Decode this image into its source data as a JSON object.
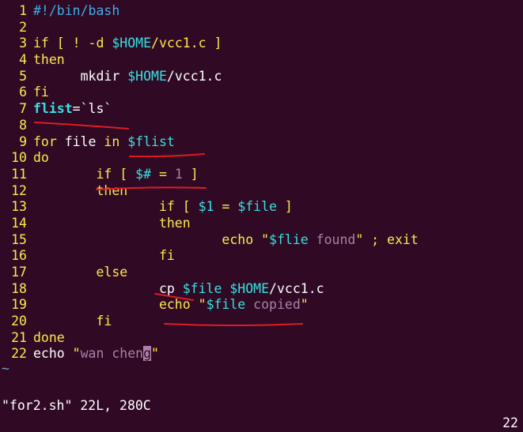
{
  "editor": {
    "lines": [
      {
        "n": "1",
        "tokens": [
          {
            "t": "#!/bin/bash",
            "c": "blue"
          }
        ]
      },
      {
        "n": "2",
        "tokens": []
      },
      {
        "n": "3",
        "tokens": [
          {
            "t": "if",
            "c": "yellow"
          },
          {
            "t": " [ ! -d ",
            "c": "yellow"
          },
          {
            "t": "$HOME",
            "c": "cyan"
          },
          {
            "t": "/vcc1.c ]",
            "c": "yellow"
          }
        ]
      },
      {
        "n": "4",
        "tokens": [
          {
            "t": "then",
            "c": "yellow"
          }
        ]
      },
      {
        "n": "5",
        "tokens": [
          {
            "t": "      mkdir ",
            "c": "white"
          },
          {
            "t": "$HOME",
            "c": "cyan"
          },
          {
            "t": "/vcc1.c",
            "c": "white"
          }
        ]
      },
      {
        "n": "6",
        "tokens": [
          {
            "t": "fi",
            "c": "yellow"
          }
        ]
      },
      {
        "n": "7",
        "tokens": [
          {
            "t": "flist",
            "c": "cyan",
            "b": true
          },
          {
            "t": "=`ls`",
            "c": "white"
          }
        ]
      },
      {
        "n": "8",
        "tokens": []
      },
      {
        "n": "9",
        "tokens": [
          {
            "t": "for",
            "c": "yellow"
          },
          {
            "t": " file ",
            "c": "white"
          },
          {
            "t": "in",
            "c": "yellow"
          },
          {
            "t": " ",
            "c": "white"
          },
          {
            "t": "$flist",
            "c": "cyan"
          }
        ]
      },
      {
        "n": "10",
        "tokens": [
          {
            "t": "do",
            "c": "yellow"
          }
        ]
      },
      {
        "n": "11",
        "tokens": [
          {
            "t": "        if",
            "c": "yellow"
          },
          {
            "t": " [ ",
            "c": "yellow"
          },
          {
            "t": "$#",
            "c": "cyan"
          },
          {
            "t": " = ",
            "c": "yellow"
          },
          {
            "t": "1",
            "c": "purple"
          },
          {
            "t": " ]",
            "c": "yellow"
          }
        ]
      },
      {
        "n": "12",
        "tokens": [
          {
            "t": "        then",
            "c": "yellow"
          }
        ]
      },
      {
        "n": "13",
        "tokens": [
          {
            "t": "                if",
            "c": "yellow"
          },
          {
            "t": " [ ",
            "c": "yellow"
          },
          {
            "t": "$1",
            "c": "cyan"
          },
          {
            "t": " = ",
            "c": "yellow"
          },
          {
            "t": "$file",
            "c": "cyan"
          },
          {
            "t": " ]",
            "c": "yellow"
          }
        ]
      },
      {
        "n": "14",
        "tokens": [
          {
            "t": "                then",
            "c": "yellow"
          }
        ]
      },
      {
        "n": "15",
        "tokens": [
          {
            "t": "                        echo ",
            "c": "yellow"
          },
          {
            "t": "\"",
            "c": "yellow"
          },
          {
            "t": "$flie",
            "c": "cyan"
          },
          {
            "t": " found",
            "c": "purple"
          },
          {
            "t": "\"",
            "c": "yellow"
          },
          {
            "t": " ; exit",
            "c": "yellow"
          }
        ]
      },
      {
        "n": "16",
        "tokens": [
          {
            "t": "                fi",
            "c": "yellow"
          }
        ]
      },
      {
        "n": "17",
        "tokens": [
          {
            "t": "        else",
            "c": "yellow"
          }
        ]
      },
      {
        "n": "18",
        "tokens": [
          {
            "t": "                cp ",
            "c": "white"
          },
          {
            "t": "$file",
            "c": "cyan"
          },
          {
            "t": " ",
            "c": "white"
          },
          {
            "t": "$HOME",
            "c": "cyan"
          },
          {
            "t": "/vcc1.c",
            "c": "white"
          }
        ]
      },
      {
        "n": "19",
        "tokens": [
          {
            "t": "                echo ",
            "c": "yellow"
          },
          {
            "t": "\"",
            "c": "yellow"
          },
          {
            "t": "$file",
            "c": "cyan"
          },
          {
            "t": " copied",
            "c": "purple"
          },
          {
            "t": "\"",
            "c": "yellow"
          }
        ]
      },
      {
        "n": "20",
        "tokens": [
          {
            "t": "        fi",
            "c": "yellow"
          }
        ]
      },
      {
        "n": "21",
        "tokens": [
          {
            "t": "done",
            "c": "yellow"
          }
        ]
      },
      {
        "n": "22",
        "tokens": [
          {
            "t": "echo ",
            "c": "white"
          },
          {
            "t": "\"",
            "c": "yellow"
          },
          {
            "t": "wan chen",
            "c": "purple"
          },
          {
            "t": "g",
            "c": "cursor"
          },
          {
            "t": "\"",
            "c": "yellow"
          }
        ]
      }
    ],
    "tilde": "~"
  },
  "statusbar": {
    "file_info": "\"for2.sh\" 22L, 280C",
    "cursor_pos": "22"
  },
  "colors": {
    "background": "#300a24",
    "keyword": "#fce94f",
    "variable": "#34e2e2",
    "comment": "#3daee9",
    "string": "#ad7fa8",
    "annotation": "#e01b24"
  }
}
